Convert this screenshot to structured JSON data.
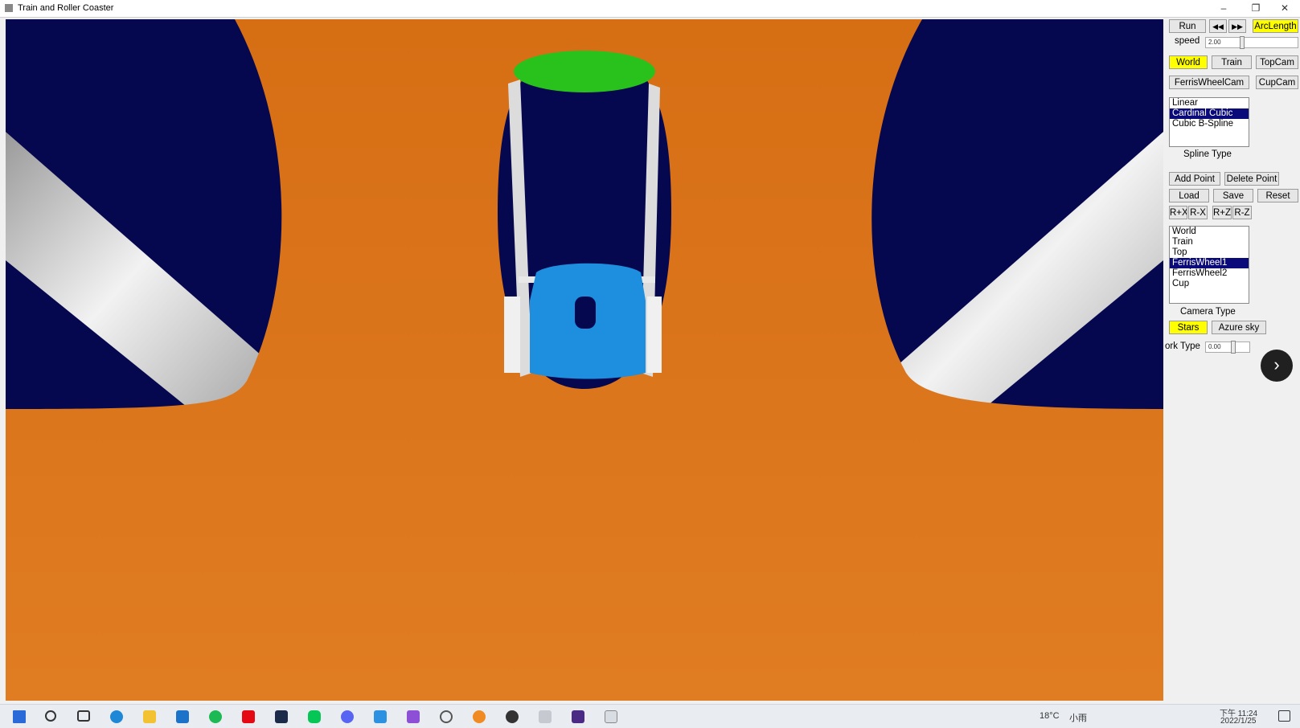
{
  "window": {
    "title": "Train and Roller Coaster",
    "min": "–",
    "max": "❐",
    "close": "✕"
  },
  "colors": {
    "sky": "#05084f",
    "orange": "#d8731a",
    "green": "#29c21d",
    "blue": "#1d8fde",
    "rail": "#d9d9d9",
    "highlight": "#ffff00",
    "selection": "#0a0a7a"
  },
  "controls": {
    "run": "Run",
    "rewind": "◀◀",
    "forward": "▶▶",
    "arclength": "ArcLength",
    "speed_label": "speed",
    "speed_value": "2.00",
    "cam_buttons": [
      "World",
      "Train",
      "TopCam"
    ],
    "ferriswheelcam": "FerrisWheelCam",
    "cupcam": "CupCam",
    "spline_types": [
      "Linear",
      "Cardinal Cubic",
      "Cubic B-Spline"
    ],
    "spline_selected": 1,
    "spline_label": "Spline Type",
    "add_point": "Add Point",
    "delete_point": "Delete Point",
    "load": "Load",
    "save": "Save",
    "reset": "Reset",
    "rotate": [
      "R+X",
      "R-X",
      "R+Z",
      "R-Z"
    ],
    "camera_types": [
      "World",
      "Train",
      "Top",
      "FerrisWheel1",
      "FerrisWheel2",
      "Cup"
    ],
    "camera_selected": 3,
    "camera_label": "Camera Type",
    "stars": "Stars",
    "azure_sky": "Azure sky",
    "work_type_label": "ork Type",
    "work_type_value": "0.00"
  },
  "overlay": {
    "next_icon": "chevron-right-icon",
    "next_glyph": "›"
  },
  "taskbar": {
    "icons": [
      "windows-start-icon",
      "search-icon",
      "task-view-icon",
      "edge-icon",
      "file-explorer-icon",
      "mail-icon",
      "spotify-icon",
      "netflix-icon",
      "terminal-icon",
      "line-icon",
      "discord-icon",
      "vscode-icon",
      "visual-studio-icon",
      "app-icon",
      "blender-icon",
      "steam-icon",
      "photos-icon",
      "video-icon",
      "active-app-icon"
    ],
    "weather": "18°C",
    "weather_desc": "小雨",
    "time": "下午 11:24",
    "date": "2022/1/25"
  }
}
